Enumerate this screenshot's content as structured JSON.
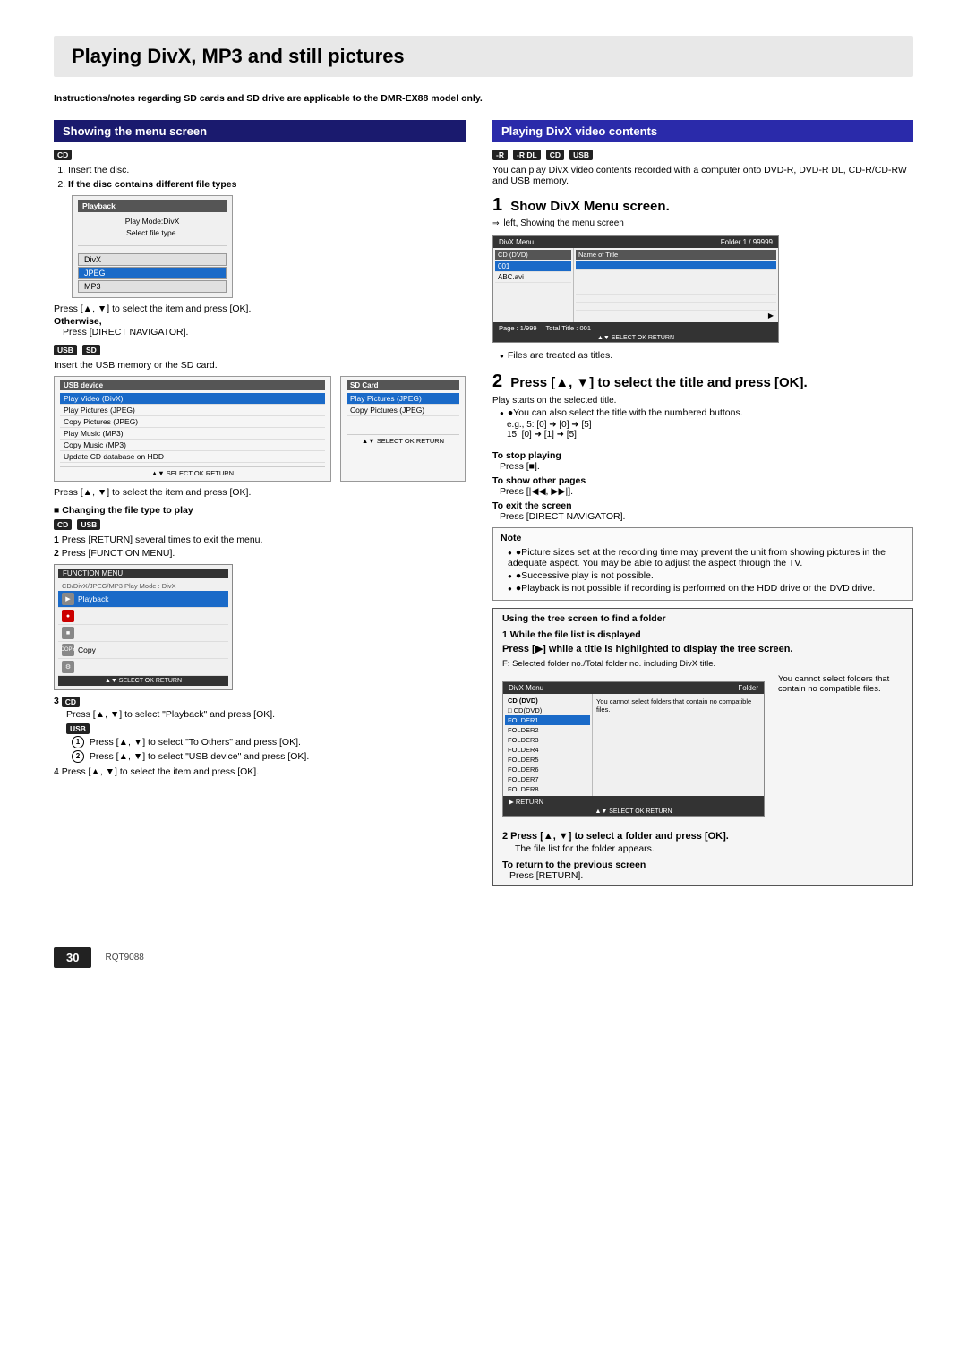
{
  "page": {
    "title": "Playing DivX, MP3 and still pictures",
    "page_number": "30",
    "rqt_code": "RQT9088"
  },
  "intro_note": "Instructions/notes regarding SD cards and SD drive are applicable to the DMR-EX88 model only.",
  "left_col": {
    "section_title": "Showing the menu screen",
    "cd_label": "CD",
    "steps": [
      {
        "num": "1",
        "text": "Insert the disc."
      },
      {
        "num": "2",
        "text": "If the disc contains different file types"
      }
    ],
    "playback_screen": {
      "title": "Playback",
      "items": [
        "Play Mode:DivX",
        "Select file type.",
        "",
        "DivX",
        "JPEG",
        "MP3"
      ]
    },
    "press_instruction": "Press [▲, ▼] to select the item and press [OK].",
    "otherwise_label": "Otherwise,",
    "otherwise_text": "Press [DIRECT NAVIGATOR].",
    "usb_sd_badges": [
      "USB",
      "SD"
    ],
    "usb_sd_text": "Insert the USB memory or the SD card.",
    "usb_screen": {
      "title": "USB device",
      "items": [
        "Play Video (DivX)",
        "Play Pictures (JPEG)",
        "Copy Pictures (JPEG)",
        "Play Music (MP3)",
        "Copy Music (MP3)",
        "Update CD database on HDD"
      ]
    },
    "sd_screen": {
      "title": "SD Card",
      "items": [
        "Play Pictures (JPEG)",
        "Copy Pictures (JPEG)"
      ]
    },
    "press_instruction2": "Press [▲, ▼] to select the item and press [OK].",
    "changing_file_header": "■ Changing the file type to play",
    "cd_usb_badges": [
      "CD",
      "USB"
    ],
    "step_return": "1   Press [RETURN] several times to exit the menu.",
    "step_func": "2   Press [FUNCTION MENU].",
    "func_screen": {
      "title": "FUNCTION MENU",
      "subtitle": "CD/DivX/JPEG/MP3    Play Mode : DivX",
      "items": [
        {
          "icon": "▶",
          "label": "Playback",
          "sel": true
        },
        {
          "icon": "●",
          "label": ""
        },
        {
          "icon": "■",
          "label": ""
        },
        {
          "icon": "C",
          "label": "Copy"
        },
        {
          "icon": "⚙",
          "label": ""
        }
      ]
    },
    "step3_cd": "CD",
    "step3_text": "Press [▲, ▼] to select \"Playback\" and press [OK].",
    "step3_usb": "USB",
    "step3_usb_text1": "①Press [▲, ▼] to select \"To Others\" and press [OK].",
    "step3_usb_text2": "②Press [▲, ▼] to select \"USB device\" and press [OK].",
    "step4_text": "4   Press [▲, ▼] to select the item and press [OK]."
  },
  "right_col": {
    "section_title": "Playing DivX video contents",
    "badges": [
      "-R",
      "-R DL",
      "CD",
      "USB"
    ],
    "intro_text": "You can play DivX video contents recorded with a computer onto DVD-R, DVD-R DL, CD-R/CD-RW and USB memory.",
    "step1": {
      "num": "1",
      "title": "Show DivX Menu screen.",
      "arrow_text": "⇒ left, Showing the menu screen",
      "screen": {
        "header_left": "DivX Menu",
        "header_right": "Folder 1 / 99999",
        "left_col_header": "CD (DVD)",
        "left_items": [
          "001",
          "ABC.avi"
        ],
        "right_col_header": "Name of Title",
        "right_items": [
          "",
          "",
          "",
          "",
          "",
          "",
          ""
        ],
        "footer_left": "Page : 1/999",
        "footer_right": "Total Title : 001"
      },
      "note": "●Files are treated as titles."
    },
    "step2": {
      "num": "2",
      "title": "Press [▲, ▼] to select the title and press [OK].",
      "sub_text": "Play starts on the selected title.",
      "note1": "●You can also select the title with the numbered buttons.",
      "eg1": "e.g.,   5:    [0] ➜ [0] ➜ [5]",
      "eg2": "        15:   [0] ➜ [1] ➜ [5]"
    },
    "stop_playing": {
      "label": "To stop playing",
      "text": "Press [■]."
    },
    "show_other_pages": {
      "label": "To show other pages",
      "text": "Press [|◀◀, ▶▶|]."
    },
    "exit_screen": {
      "label": "To exit the screen",
      "text": "Press [DIRECT NAVIGATOR]."
    },
    "note_box": {
      "items": [
        "●Picture sizes set at the recording time may prevent the unit from showing pictures in the adequate aspect. You may be able to adjust the aspect through the TV.",
        "●Successive play is not possible.",
        "●Playback is not possible if recording is performed on the HDD drive or the DVD drive."
      ]
    },
    "tree_section": {
      "header": "Using the tree screen to find a folder",
      "step1_label": "1   While the file list is displayed",
      "step1_bold": "Press [▶] while a title is highlighted to display the tree screen.",
      "f_note": "F: Selected folder no./Total folder no. including DivX title.",
      "tree_screen": {
        "header_left": "DivX Menu",
        "header_right": "Folder",
        "left_col_header": "CD (DVD)",
        "left_items": [
          "CDCD-DVD",
          "FOLDER1",
          "FOLDER2",
          "FOLDER3",
          "FOLDER4",
          "FOLDER5",
          "FOLDER6",
          "FOLDER7",
          "FOLDER8"
        ],
        "right_note": "You cannot select folders that contain no compatible files.",
        "footer": "▶ RETURN"
      },
      "step2_text": "2   Press [▲, ▼] to select a folder and press [OK].",
      "step2_sub": "The file list for the folder appears.",
      "return_label": "To return to the previous screen",
      "return_text": "Press [RETURN]."
    }
  }
}
